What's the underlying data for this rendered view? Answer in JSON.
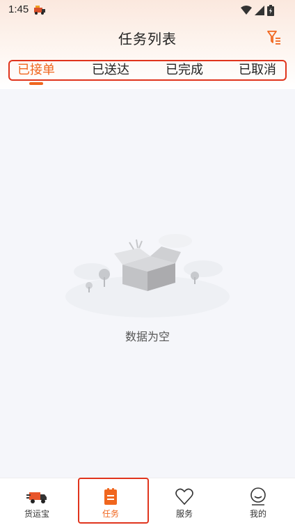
{
  "status_bar": {
    "time": "1:45"
  },
  "header": {
    "title": "任务列表"
  },
  "tabs": [
    {
      "label": "已接单",
      "active": true
    },
    {
      "label": "已送达",
      "active": false
    },
    {
      "label": "已完成",
      "active": false
    },
    {
      "label": "已取消",
      "active": false
    }
  ],
  "empty_state": {
    "text": "数据为空"
  },
  "bottom_nav": [
    {
      "label": "货运宝",
      "icon": "truck-icon",
      "active": false
    },
    {
      "label": "任务",
      "icon": "task-clipboard-icon",
      "active": true
    },
    {
      "label": "服务",
      "icon": "heart-icon",
      "active": false
    },
    {
      "label": "我的",
      "icon": "profile-icon",
      "active": false
    }
  ],
  "colors": {
    "accent": "#f0661e",
    "highlight": "#e0341c"
  }
}
